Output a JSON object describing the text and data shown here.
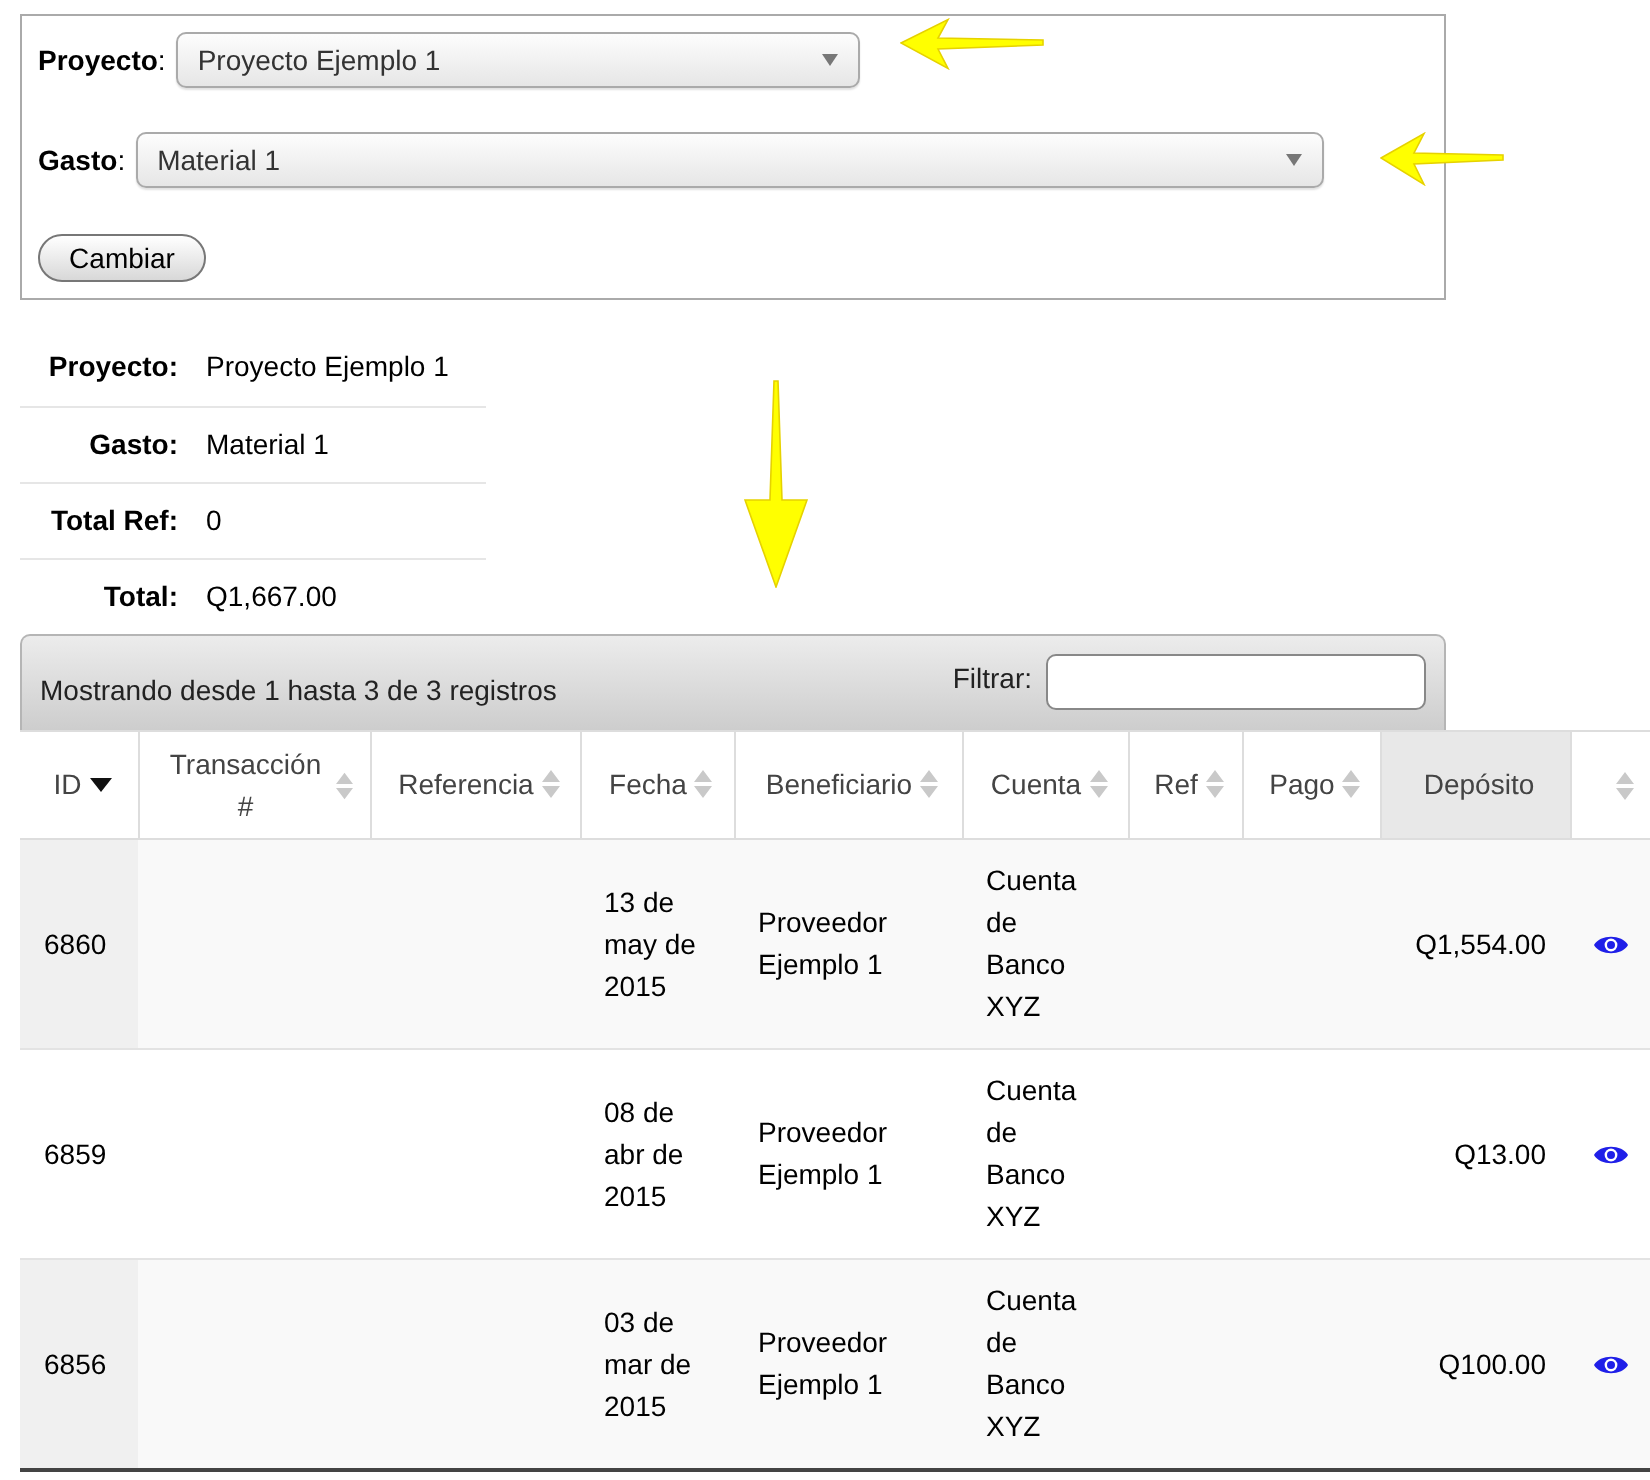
{
  "form": {
    "fields": [
      {
        "label": "**Proyecto**:",
        "value": "Proyecto Ejemplo 1"
      },
      {
        "label": "**Gasto**:",
        "value": "Material 1"
      }
    ],
    "submit_button": "Cambiar"
  },
  "summary": [
    {
      "label": "Proyecto:",
      "value": "Proyecto Ejemplo 1"
    },
    {
      "label": "Gasto:",
      "value": "Material 1"
    },
    {
      "label": "Total Ref:",
      "value": "0"
    },
    {
      "label": "Total:",
      "value": "Q1,667.00"
    }
  ],
  "table": {
    "info": "Mostrando desde 1 hasta 3 de 3 registros",
    "filter_label": "Filtrar:",
    "columns": [
      {
        "label": "ID",
        "sortable": true,
        "sorted": true,
        "highlighted": false
      },
      {
        "label": "Transacción #",
        "sortable": true,
        "sorted": false,
        "highlighted": false
      },
      {
        "label": "Referencia",
        "sortable": true,
        "sorted": false,
        "highlighted": false
      },
      {
        "label": "Fecha",
        "sortable": true,
        "sorted": false,
        "highlighted": false
      },
      {
        "label": "Beneficiario",
        "sortable": true,
        "sorted": false,
        "highlighted": false
      },
      {
        "label": "Cuenta",
        "sortable": true,
        "sorted": false,
        "highlighted": false
      },
      {
        "label": "Ref",
        "sortable": true,
        "sorted": false,
        "highlighted": false
      },
      {
        "label": "Pago",
        "sortable": true,
        "sorted": false,
        "highlighted": false
      },
      {
        "label": "Depósito",
        "sortable": false,
        "sorted": false,
        "highlighted": true
      },
      {
        "sortable": true,
        "sorted": false,
        "highlighted": false
      }
    ],
    "rows": [
      {
        "id": "6860",
        "fecha": "13 de may de 2015",
        "beneficiario": "Proveedor Ejemplo 1",
        "cuenta": "Cuenta de Banco XYZ",
        "deposito": "Q1,554.00"
      },
      {
        "id": "6859",
        "fecha": "08 de abr de 2015",
        "beneficiario": "Proveedor Ejemplo 1",
        "cuenta": "Cuenta de Banco XYZ",
        "deposito": "Q13.00"
      },
      {
        "id": "6856",
        "fecha": "03 de mar de 2015",
        "beneficiario": "Proveedor Ejemplo 1",
        "cuenta": "Cuenta de Banco XYZ",
        "deposito": "Q100.00"
      }
    ]
  }
}
